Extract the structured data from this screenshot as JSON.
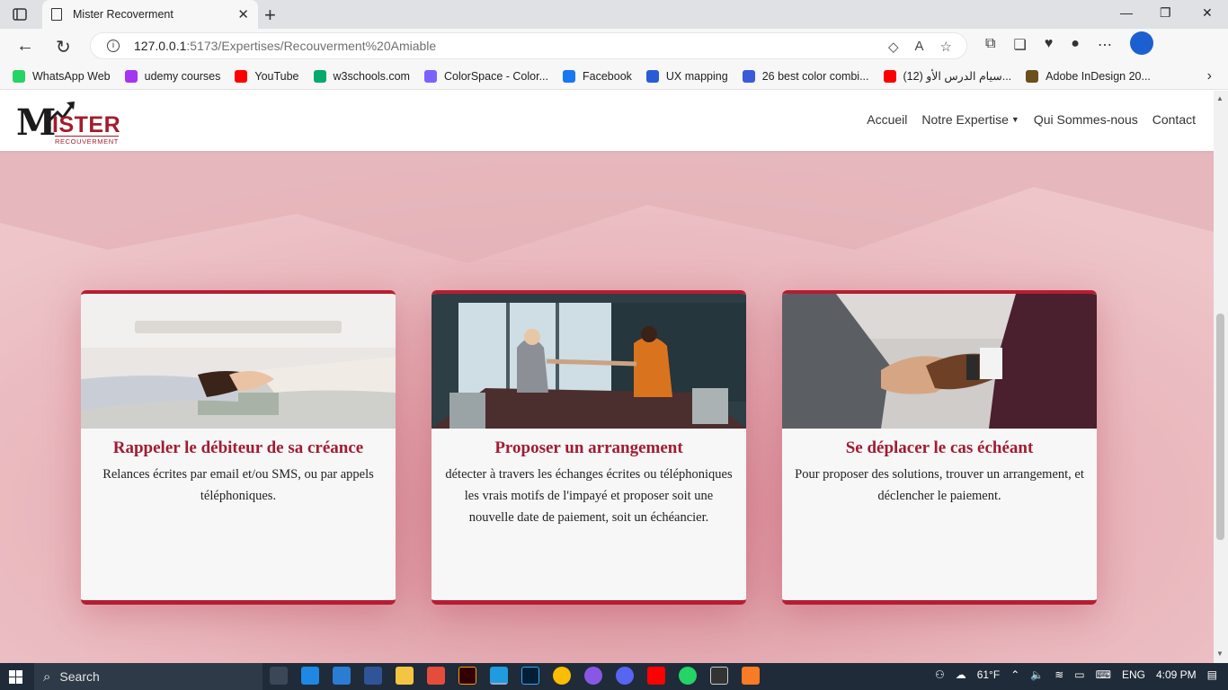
{
  "browser": {
    "tab_title": "Mister Recoverment",
    "url_host": "127.0.0.1",
    "url_path": ":5173/Expertises/Recouverment%20Amiable",
    "bookmarks": [
      {
        "label": "WhatsApp Web",
        "color": "#25d366"
      },
      {
        "label": "udemy courses",
        "color": "#a435f0"
      },
      {
        "label": "YouTube",
        "color": "#ff0000"
      },
      {
        "label": "w3schools.com",
        "color": "#04aa6d"
      },
      {
        "label": "ColorSpace - Color...",
        "color": "#7b61ff"
      },
      {
        "label": "Facebook",
        "color": "#1877f2"
      },
      {
        "label": "UX mapping",
        "color": "#2a5bd7"
      },
      {
        "label": "26 best color combi...",
        "color": "#3b5bdb"
      },
      {
        "label": "(12) سيام الدرس الأو...",
        "color": "#ff0000"
      },
      {
        "label": "Adobe InDesign 20...",
        "color": "#6b4f1d"
      }
    ]
  },
  "site": {
    "logo": {
      "big": "M",
      "rest": "ISTER",
      "sub": "RECOUVERMENT"
    },
    "nav": {
      "home": "Accueil",
      "expertise": "Notre Expertise",
      "about": "Qui Sommes-nous",
      "contact": "Contact"
    },
    "cards": [
      {
        "title": "Rappeler le débiteur de sa créance",
        "text": "Relances écrites par email et/ou SMS, ou par appels téléphoniques."
      },
      {
        "title": "Proposer un arrangement",
        "text": "détecter à travers les échanges écrites ou téléphoniques les vrais motifs de l'impayé et proposer soit une nouvelle date de paiement, soit un échéancier."
      },
      {
        "title": "Se déplacer le cas échéant",
        "text": "Pour proposer des solutions, trouver un arrangement, et déclencher le paiement."
      }
    ],
    "colors": {
      "accent": "#b51d33",
      "background": "#eabec3"
    }
  },
  "taskbar": {
    "search": "Search",
    "weather": "61°F",
    "lang": "ENG",
    "time": "4:09 PM"
  }
}
